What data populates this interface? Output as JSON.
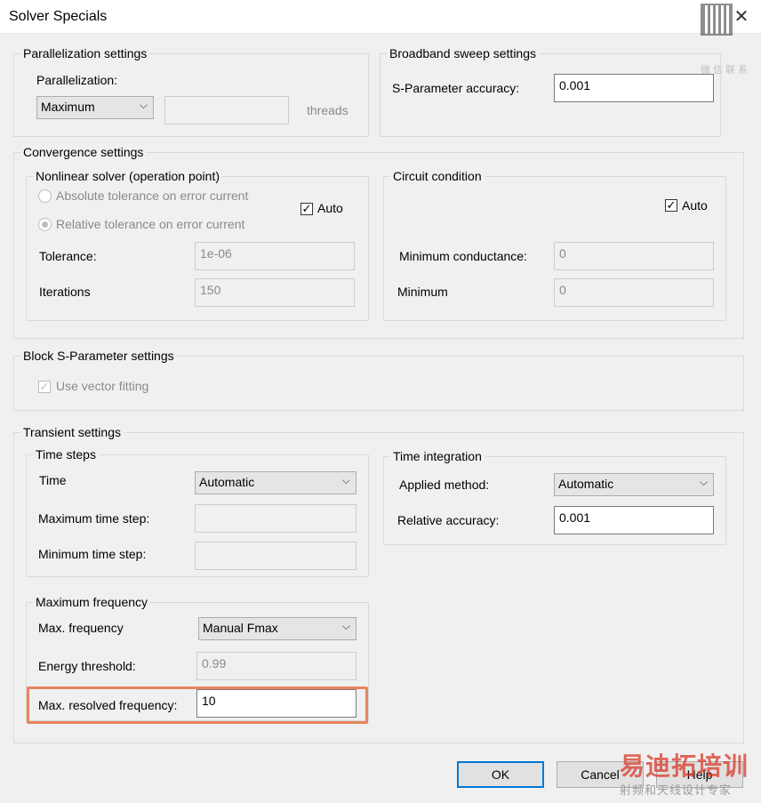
{
  "window": {
    "title": "Solver Specials",
    "close_glyph": "✕"
  },
  "watermark": {
    "qr_caption": "微信联系",
    "brand": "易迪拓培训",
    "slogan": "射频和天线设计专家"
  },
  "parallelization": {
    "legend": "Parallelization settings",
    "label": "Parallelization:",
    "selected": "Maximum",
    "threads_value": "",
    "threads_label": "threads"
  },
  "broadband": {
    "legend": "Broadband sweep settings",
    "accuracy_label": "S-Parameter accuracy:",
    "accuracy_value": "0.001"
  },
  "convergence": {
    "legend": "Convergence settings",
    "nonlinear": {
      "legend": "Nonlinear solver (operation point)",
      "radio_absolute": "Absolute tolerance on error current",
      "radio_relative": "Relative tolerance on error current",
      "auto_label": "Auto",
      "tolerance_label": "Tolerance:",
      "tolerance_value": "1e-06",
      "iterations_label": "Iterations",
      "iterations_value": "150"
    },
    "circuit": {
      "legend": "Circuit condition",
      "auto_label": "Auto",
      "min_conductance_label": "Minimum conductance:",
      "min_conductance_value": "0",
      "minimum_label": "Minimum",
      "minimum_value": "0"
    }
  },
  "block_sparam": {
    "legend": "Block S-Parameter settings",
    "vector_fitting_label": "Use vector fitting"
  },
  "transient": {
    "legend": "Transient settings",
    "time_steps": {
      "legend": "Time steps",
      "time_label": "Time",
      "time_selected": "Automatic",
      "max_step_label": "Maximum time step:",
      "max_step_value": "",
      "min_step_label": "Minimum time step:",
      "min_step_value": ""
    },
    "time_integration": {
      "legend": "Time integration",
      "method_label": "Applied method:",
      "method_selected": "Automatic",
      "rel_accuracy_label": "Relative accuracy:",
      "rel_accuracy_value": "0.001"
    },
    "max_frequency": {
      "legend": "Maximum frequency",
      "fmax_label": "Max. frequency",
      "fmax_selected": "Manual Fmax",
      "energy_label": "Energy threshold:",
      "energy_value": "0.99",
      "resolved_label": "Max. resolved frequency:",
      "resolved_value": "10"
    }
  },
  "buttons": {
    "ok": "OK",
    "cancel": "Cancel",
    "help": "Help"
  },
  "colors": {
    "highlight": "#e8845e",
    "focus": "#0078d7"
  }
}
